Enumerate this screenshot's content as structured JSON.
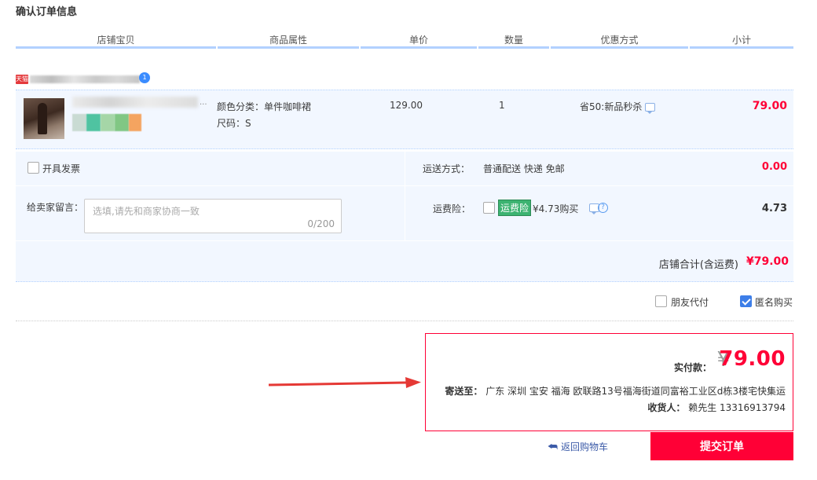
{
  "page": {
    "title": "确认订单信息"
  },
  "columns": [
    "店铺宝贝",
    "商品属性",
    "单价",
    "数量",
    "优惠方式",
    "小计"
  ],
  "shop": {
    "badge": "天猫",
    "ww_label": "1"
  },
  "item": {
    "title_ellipsis": "...",
    "sku_color": "颜色分类：单件咖啡裙",
    "sku_size": "尺码：S",
    "price": "129.00",
    "quantity": "1",
    "promo": "省50:新品秒杀",
    "subtotal": "79.00",
    "swatch_colors": [
      "#4fc3a1",
      "#a5d6a7",
      "#81c784",
      "#ffcc80",
      "#f4a460"
    ]
  },
  "options": {
    "invoice_label": "开具发票",
    "delivery_label": "运送方式：",
    "delivery_value": "普通配送 快递 免邮",
    "delivery_fee": "0.00",
    "message_label": "给卖家留言：",
    "message_placeholder": "选填,请先和商家协商一致",
    "message_count": "0/200",
    "insurance_label": "运费险：",
    "insurance_tag": "运费险",
    "insurance_text": "¥4.73购买",
    "insurance_fee": "4.73",
    "shop_total_label": "店铺合计(含运费)",
    "shop_total_value": "¥79.00"
  },
  "extras": {
    "friend_pay_label": "朋友代付",
    "anonymous_label": "匿名购买",
    "anonymous_checked": true
  },
  "summary": {
    "pay_label": "实付款：",
    "yen": "¥",
    "pay_amount": "79.00",
    "ship_label": "寄送至：",
    "ship_address": "广东 深圳 宝安 福海 欧联路13号福海街道同富裕工业区d栋3楼宅快集运",
    "receiver_label": "收货人：",
    "receiver_value": "赖先生 13316913794"
  },
  "actions": {
    "back_label": "返回购物车",
    "submit_label": "提交订单"
  },
  "colors": {
    "accent_red": "#ff0036",
    "header_blue": "#b2d1ff",
    "panel_bg": "#f2f7ff"
  }
}
